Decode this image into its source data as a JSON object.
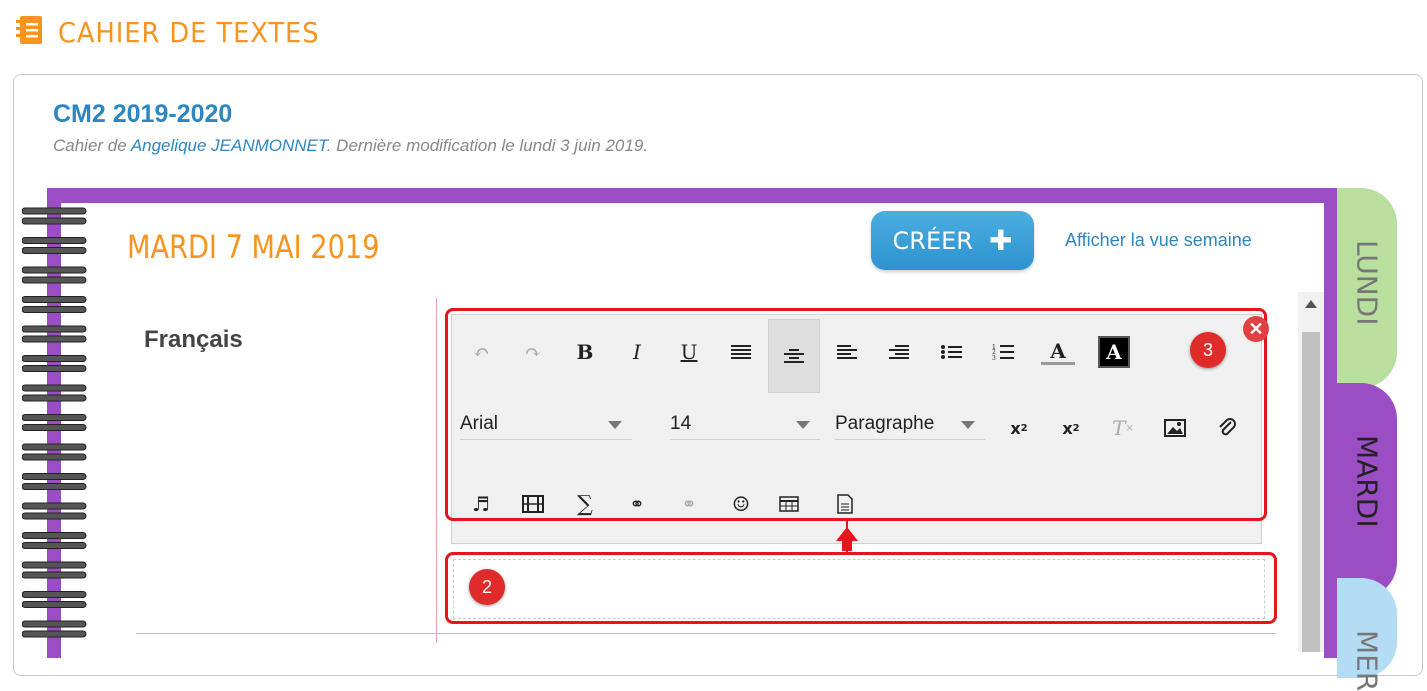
{
  "header": {
    "title": "CAHIER DE TEXTES",
    "icon": "notebook-icon"
  },
  "course": {
    "title": "CM2 2019-2020",
    "prefix": "Cahier de ",
    "author": "Angelique JEANMONNET",
    "suffix": ". Dernière modification le lundi 3 juin 2019."
  },
  "day": {
    "date": "MARDI 7 MAI 2019",
    "create_label": "CRÉER",
    "create_icon": "plus-icon",
    "week_link": "Afficher la vue semaine"
  },
  "tabs": [
    "LUNDI",
    "MARDI",
    "MER"
  ],
  "subject": "Français",
  "toolbar": {
    "row1": [
      "undo-icon",
      "redo-icon",
      "bold-icon",
      "italic-icon",
      "underline-icon",
      "justify-icon",
      "align-center-icon",
      "align-left-icon",
      "align-right-icon",
      "bullet-list-icon",
      "numbered-list-icon",
      "text-color-icon",
      "background-color-icon"
    ],
    "font": "Arial",
    "size": "14",
    "format": "Paragraphe",
    "row3": [
      "audio-icon",
      "video-icon",
      "formula-icon",
      "link-icon",
      "unlink-icon",
      "emoji-icon",
      "table-icon",
      "template-icon"
    ]
  },
  "annotations": {
    "editor_badge": "2",
    "toolbar_badge": "3"
  },
  "colors": {
    "accent_orange": "#f7931e",
    "link_blue": "#2c86c0",
    "book_purple": "#9b4ec4",
    "highlight_red": "#e8141b"
  }
}
